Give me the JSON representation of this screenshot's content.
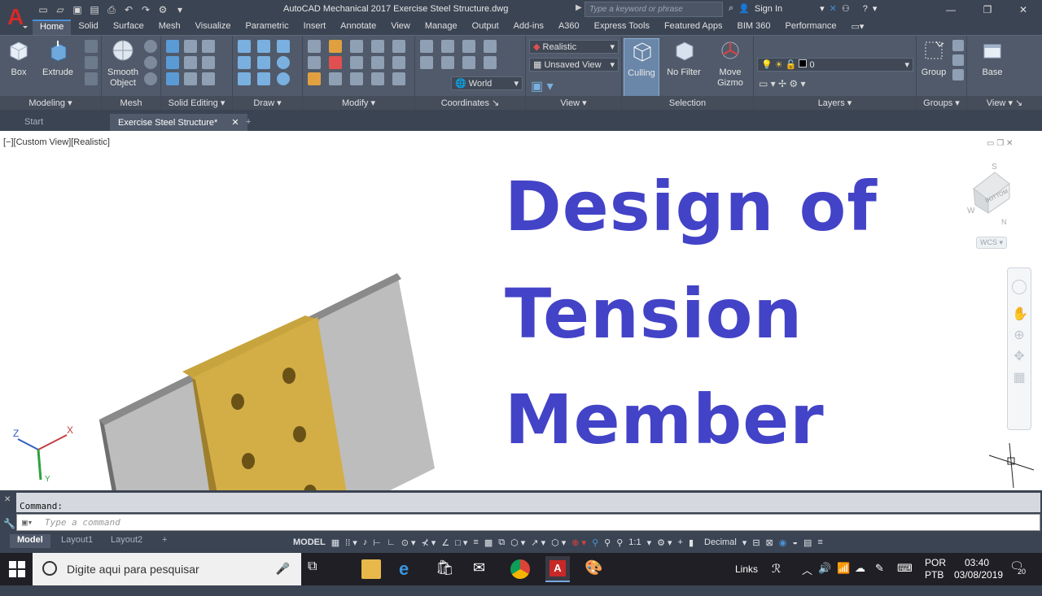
{
  "app": {
    "title": "AutoCAD Mechanical 2017    Exercise Steel Structure.dwg",
    "search_placeholder": "Type a keyword or phrase",
    "sign_in": "Sign In",
    "logo_letter": "A"
  },
  "ribbon_tabs": [
    "Home",
    "Solid",
    "Surface",
    "Mesh",
    "Visualize",
    "Parametric",
    "Insert",
    "Annotate",
    "View",
    "Manage",
    "Output",
    "Add-ins",
    "A360",
    "Express Tools",
    "Featured Apps",
    "BIM 360",
    "Performance"
  ],
  "panels": {
    "modeling": "Modeling",
    "mesh": "Mesh",
    "solid_editing": "Solid Editing",
    "draw": "Draw",
    "modify": "Modify",
    "coordinates": "Coordinates",
    "view": "View",
    "selection": "Selection",
    "layers": "Layers",
    "groups": "Groups",
    "view2": "View"
  },
  "buttons": {
    "box": "Box",
    "extrude": "Extrude",
    "smooth_object_1": "Smooth",
    "smooth_object_2": "Object",
    "culling": "Culling",
    "no_filter": "No Filter",
    "move_gizmo_1": "Move",
    "move_gizmo_2": "Gizmo",
    "group": "Group",
    "base": "Base"
  },
  "dropdowns": {
    "visual_style": "Realistic",
    "saved_view": "Unsaved View",
    "ucs": "World",
    "layer": "0"
  },
  "doc_tabs": [
    "Start",
    "Exercise Steel Structure*"
  ],
  "viewport": {
    "label": "[−][Custom View][Realistic]",
    "headline": [
      "Design of",
      "Tension",
      "Member"
    ],
    "wcs": "WCS",
    "axis_z": "Z",
    "axis_x": "X",
    "axis_y": "Y",
    "cube_s": "S",
    "cube_w": "W",
    "cube_n": "N",
    "cube_face": "BOTTOM"
  },
  "command": {
    "history": "Command:",
    "placeholder": "Type  a  command"
  },
  "layout_tabs": [
    "Model",
    "Layout1",
    "Layout2"
  ],
  "status": {
    "model": "MODEL",
    "scale": "1:1",
    "units": "Decimal"
  },
  "taskbar": {
    "search": "Digite aqui para pesquisar",
    "links": "Links",
    "lang1": "POR",
    "lang2": "PTB",
    "time": "03:40",
    "date": "03/08/2019",
    "notif": "20"
  },
  "colors": {
    "headline": "#4343c8",
    "plate_gray": "#b9b9b9",
    "plate_gold": "#d2ad45",
    "ribbon": "#505a6a"
  }
}
